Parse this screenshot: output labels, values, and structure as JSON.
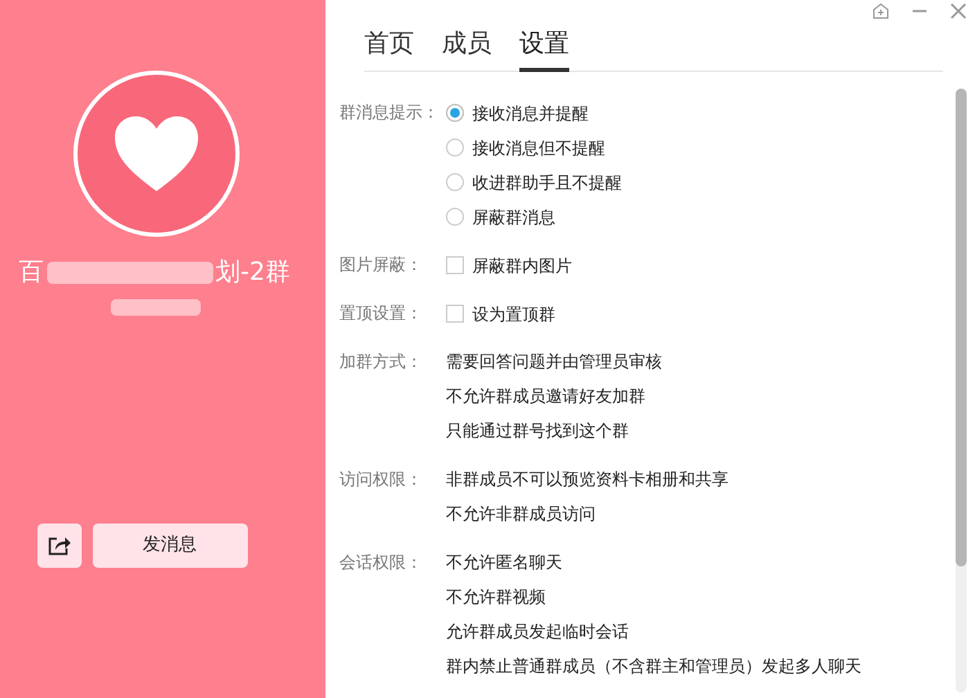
{
  "profile": {
    "name_start": "百",
    "name_end": "划-2群",
    "message_button": "发消息"
  },
  "tabs": [
    {
      "label": "首页",
      "selected": false
    },
    {
      "label": "成员",
      "selected": false
    },
    {
      "label": "设置",
      "selected": true
    }
  ],
  "settings": [
    {
      "label": "群消息提示：",
      "kind": "radio",
      "options": [
        {
          "text": "接收消息并提醒",
          "selected": true
        },
        {
          "text": "接收消息但不提醒",
          "selected": false
        },
        {
          "text": "收进群助手且不提醒",
          "selected": false
        },
        {
          "text": "屏蔽群消息",
          "selected": false
        }
      ]
    },
    {
      "label": "图片屏蔽：",
      "kind": "checkbox",
      "options": [
        {
          "text": "屏蔽群内图片",
          "checked": false
        }
      ]
    },
    {
      "label": "置顶设置：",
      "kind": "checkbox",
      "options": [
        {
          "text": "设为置顶群",
          "checked": false
        }
      ]
    },
    {
      "label": "加群方式：",
      "kind": "text",
      "lines": [
        "需要回答问题并由管理员审核",
        "不允许群成员邀请好友加群",
        "只能通过群号找到这个群"
      ]
    },
    {
      "label": "访问权限：",
      "kind": "text",
      "lines": [
        "非群成员不可以预览资料卡相册和共享",
        "不允许非群成员访问"
      ]
    },
    {
      "label": "会话权限：",
      "kind": "text",
      "lines": [
        "不允许匿名聊天",
        "不允许群视频",
        "允许群成员发起临时会话",
        "群内禁止普通群成员（不含群主和管理员）发起多人聊天"
      ]
    }
  ]
}
